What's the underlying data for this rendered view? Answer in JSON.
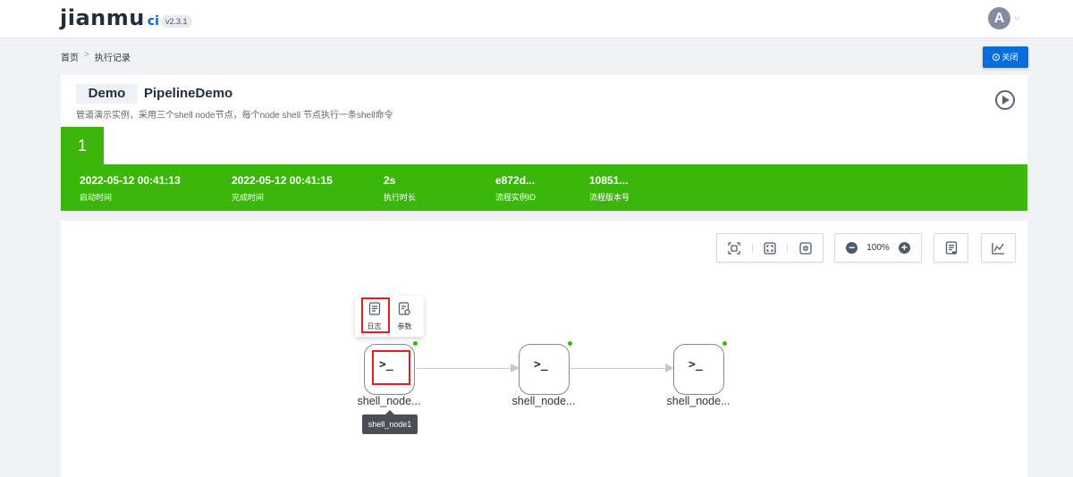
{
  "header": {
    "logo_main": "jianmu",
    "logo_suffix": "ci",
    "version": "v2.3.1",
    "avatar_letter": "A",
    "avatar_caret": "⌵"
  },
  "breadcrumb": {
    "home": "首页",
    "separator": ">",
    "current": "执行记录"
  },
  "actions": {
    "close_label": "关闭"
  },
  "pipeline": {
    "project_tag": "Demo",
    "name": "PipelineDemo",
    "description": "管道演示实例，采用三个shell node节点，每个node shell 节点执行一条shell命令",
    "run_number": "1",
    "status_color": "#3ab70a",
    "stats": [
      {
        "value": "2022-05-12 00:41:13",
        "label": "启动时间"
      },
      {
        "value": "2022-05-12 00:41:15",
        "label": "完成时间"
      },
      {
        "value": "2s",
        "label": "执行时长"
      },
      {
        "value": "e872d...",
        "label": "流程实例ID"
      },
      {
        "value": "10851...",
        "label": "流程版本号"
      }
    ]
  },
  "toolbar": {
    "zoom": "100%",
    "zoom_out": "−",
    "zoom_in": "+",
    "icons": [
      "fit-view-icon",
      "fullscreen-icon",
      "actual-size-icon",
      "zoom-out-icon",
      "zoom-in-icon",
      "log-document-icon",
      "trend-chart-icon"
    ]
  },
  "workflow": {
    "nodes": [
      {
        "label": "shell_node...",
        "prompt": ">_",
        "status": "success"
      },
      {
        "label": "shell_node...",
        "prompt": ">_",
        "status": "success"
      },
      {
        "label": "shell_node...",
        "prompt": ">_",
        "status": "success"
      }
    ],
    "node_menu": {
      "log_label": "日志",
      "params_label": "参数"
    },
    "tooltip": "shell_node1"
  }
}
